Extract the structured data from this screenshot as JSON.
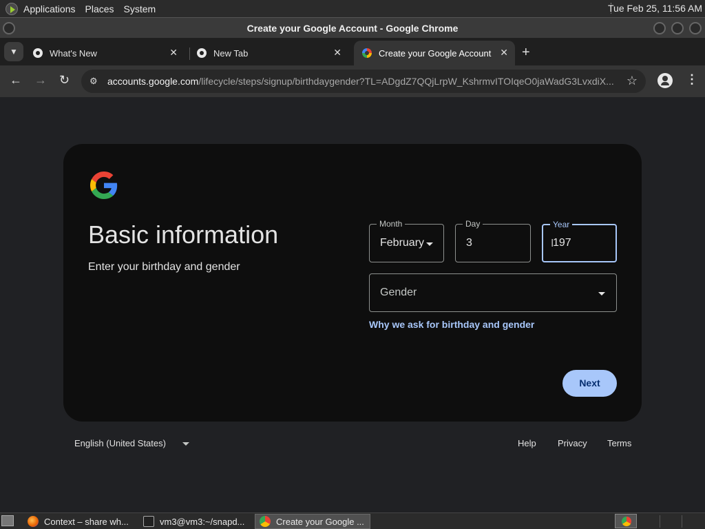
{
  "top_panel": {
    "menu": [
      "Applications",
      "Places",
      "System"
    ],
    "clock": "Tue Feb 25, 11:56 AM"
  },
  "window": {
    "title": "Create your Google Account - Google Chrome"
  },
  "tabs": [
    {
      "label": "What's New",
      "active": false
    },
    {
      "label": "New Tab",
      "active": false
    },
    {
      "label": "Create your Google Account",
      "active": true
    }
  ],
  "toolbar": {
    "url_host": "accounts.google.com",
    "url_path": "/lifecycle/steps/signup/birthdaygender?TL=ADgdZ7QQjLrpW_KshrmvITOIqeO0jaWadG3LvxdiX..."
  },
  "form": {
    "heading": "Basic information",
    "subheading": "Enter your birthday and gender",
    "month": {
      "label": "Month",
      "value": "February"
    },
    "day": {
      "label": "Day",
      "value": "3"
    },
    "year": {
      "label": "Year",
      "value": "197"
    },
    "gender": {
      "placeholder": "Gender"
    },
    "why_link": "Why we ask for birthday and gender",
    "next": "Next"
  },
  "footer": {
    "language": "English (United States)",
    "links": [
      "Help",
      "Privacy",
      "Terms"
    ]
  },
  "taskbar": [
    {
      "label": "Context – share wh...",
      "icon": "firefox-icon"
    },
    {
      "label": "vm3@vm3:~/snapd...",
      "icon": "terminal-icon"
    },
    {
      "label": "Create your Google ...",
      "icon": "chrome-icon",
      "active": true
    }
  ],
  "colors": {
    "accent": "#a8c7fa",
    "button_text": "#062e6f",
    "card": "#0e0e0e",
    "page": "#202124"
  }
}
